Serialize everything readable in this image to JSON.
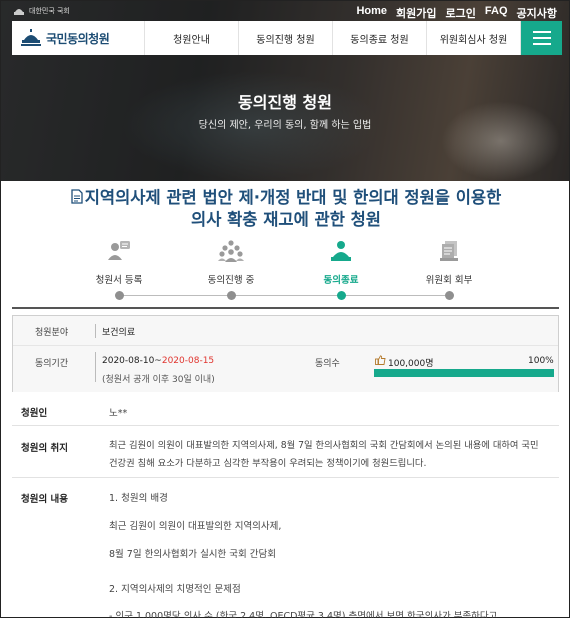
{
  "header": {
    "gov_label": "대한민국 국회",
    "util_links": [
      "Home",
      "회원가입",
      "로그인",
      "FAQ",
      "공지사항"
    ],
    "logo_text": "국민동의청원",
    "nav": [
      "청원안내",
      "동의진행 청원",
      "동의종료 청원",
      "위원회심사 청원"
    ],
    "hero_title": "동의진행 청원",
    "hero_subtitle": "당신의 제안, 우리의 동의, 함께 하는 입법"
  },
  "petition": {
    "title_line1": "지역의사제 관련 법안 제·개정 반대 및 한의대 정원을 이용한",
    "title_line2": "의사 확충 재고에 관한 청원"
  },
  "steps": [
    {
      "label": "청원서 등록",
      "icon": "register-icon",
      "active": false
    },
    {
      "label": "동의진행 중",
      "icon": "people-group-icon",
      "active": false
    },
    {
      "label": "동의종료",
      "icon": "person-check-icon",
      "active": true
    },
    {
      "label": "위원회 회부",
      "icon": "documents-stack-icon",
      "active": false
    }
  ],
  "info": {
    "field_label": "청원분야",
    "field_value": "보건의료",
    "period_label": "동의기간",
    "period_start": "2020-08-10~",
    "period_end": "2020-08-15",
    "period_note": "(청원서 공개 이후 30일 이내)",
    "agree_label": "동의수",
    "agree_count": "100,000명",
    "agree_percent": "100%",
    "agree_progress": 1.0
  },
  "fields": {
    "petitioner_label": "청원인",
    "petitioner_value": "노**",
    "purpose_label": "청원의 취지",
    "purpose_text": "최근 김원이 의원이 대표발의한 지역의사제, 8월 7일 한의사협회의 국회 간담회에서 논의된 내용에 대하여 국민 건강권 침해 요소가 다분하고 심각한 부작용이 우려되는 정책이기에 청원드립니다.",
    "content_label": "청원의 내용",
    "content_lines": [
      "1. 청원의 배경",
      "최근 김원이 의원이 대표발의한 지역의사제,",
      "8월 7일 한의사협회가 실시한 국회 간담회",
      "",
      "2. 지역의사제의 치명적인 문제점",
      "- 인구 1,000명당 의사 수 (한국 2.4명, OECD평균 3.4명) 측면에서 보면 한국의사가 부족하다고"
    ]
  },
  "colors": {
    "accent_green": "#16a98c",
    "title_blue": "#1f4f7a",
    "date_red": "#e0352f"
  }
}
